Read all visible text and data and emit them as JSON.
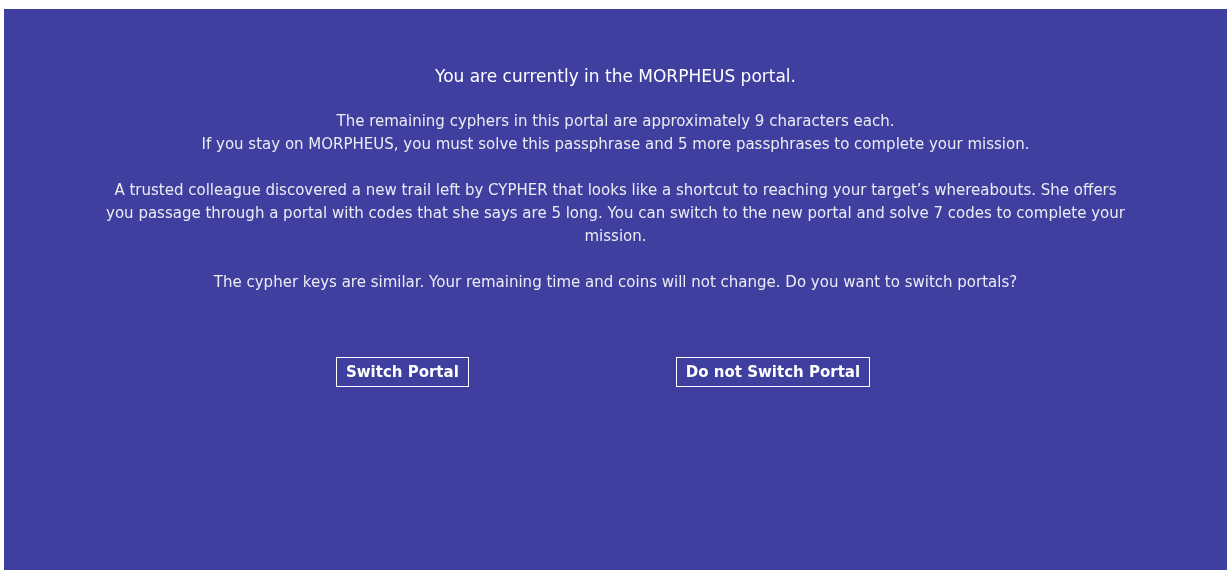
{
  "heading": "You are currently in the MORPHEUS portal.",
  "paragraphs": [
    [
      "The remaining cyphers in this portal are approximately 9 characters each.",
      "If you stay on MORPHEUS, you must solve this passphrase and 5 more passphrases to complete your mission."
    ],
    [
      "A trusted colleague discovered a new trail left by CYPHER that looks like a shortcut to reaching your target’s whereabouts. She offers you passage through a portal with codes that she says are 5 long. You can switch to the new portal and solve 7 codes to complete your mission."
    ],
    [
      "The cypher keys are similar. Your remaining time and coins will not change. Do you want to switch portals?"
    ]
  ],
  "buttons": [
    "Switch Portal",
    "Do not Switch Portal"
  ]
}
